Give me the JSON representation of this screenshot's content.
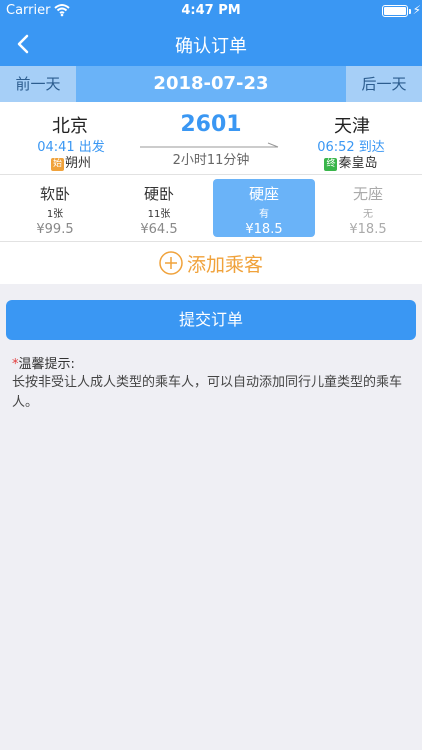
{
  "status": {
    "carrier": "Carrier",
    "time": "4:47 PM"
  },
  "nav": {
    "title": "确认订单"
  },
  "datebar": {
    "prev_label": "前一天",
    "date": "2018-07-23",
    "next_label": "后一天"
  },
  "train": {
    "from": {
      "city": "北京",
      "time": "04:41 出发",
      "tag": "始",
      "station": "朔州"
    },
    "to": {
      "city": "天津",
      "time": "06:52 到达",
      "tag": "终",
      "station": "秦皇岛"
    },
    "code": "2601",
    "duration": "2小时11分钟"
  },
  "seats": [
    {
      "name": "软卧",
      "count": "1张",
      "price": "¥99.5"
    },
    {
      "name": "硬卧",
      "count": "11张",
      "price": "¥64.5"
    },
    {
      "name": "硬座",
      "count": "有",
      "price": "¥18.5"
    },
    {
      "name": "无座",
      "count": "无",
      "price": "¥18.5"
    }
  ],
  "add_passenger_label": "添加乘客",
  "submit_label": "提交订单",
  "tip": {
    "star": "*",
    "title": "温馨提示:",
    "text": "长按非受让人成人类型的乘车人，可以自动添加同行儿童类型的乘车人。"
  },
  "colors": {
    "primary": "#3a97f3",
    "accent_orange": "#f0a23b"
  }
}
